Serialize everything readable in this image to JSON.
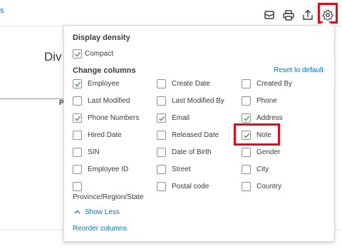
{
  "background": {
    "partial_link": "s",
    "partial_title": "Div",
    "partial_header_letter": "P"
  },
  "toolbar": {
    "icons": [
      "email-icon",
      "print-icon",
      "export-icon",
      "gear-icon"
    ]
  },
  "panel": {
    "display_density_title": "Display density",
    "compact_label": "Compact",
    "compact_checked": true,
    "change_columns_title": "Change columns",
    "reset_label": "Reset to default",
    "columns": [
      {
        "label": "Employee",
        "checked": true
      },
      {
        "label": "Create Date",
        "checked": false
      },
      {
        "label": "Created By",
        "checked": false
      },
      {
        "label": "Last Modified",
        "checked": false
      },
      {
        "label": "Last Modified By",
        "checked": false
      },
      {
        "label": "Phone",
        "checked": false
      },
      {
        "label": "Phone Numbers",
        "checked": true
      },
      {
        "label": "Email",
        "checked": true
      },
      {
        "label": "Address",
        "checked": true
      },
      {
        "label": "Hired Date",
        "checked": false
      },
      {
        "label": "Released Date",
        "checked": false
      },
      {
        "label": "Note",
        "checked": true
      },
      {
        "label": "SIN",
        "checked": false
      },
      {
        "label": "Date of Birth",
        "checked": false
      },
      {
        "label": "Gender",
        "checked": false
      },
      {
        "label": "Employee ID",
        "checked": false
      },
      {
        "label": "Street",
        "checked": false
      },
      {
        "label": "City",
        "checked": false
      },
      {
        "label": "Province/Region/State",
        "checked": false
      },
      {
        "label": "Postal code",
        "checked": false
      },
      {
        "label": "Country",
        "checked": false
      }
    ],
    "show_less_label": "Show Less",
    "reorder_label": "Reorder columns"
  },
  "colors": {
    "check": "#2ca01c",
    "link": "#0077c5",
    "highlight": "#e20a1a"
  }
}
